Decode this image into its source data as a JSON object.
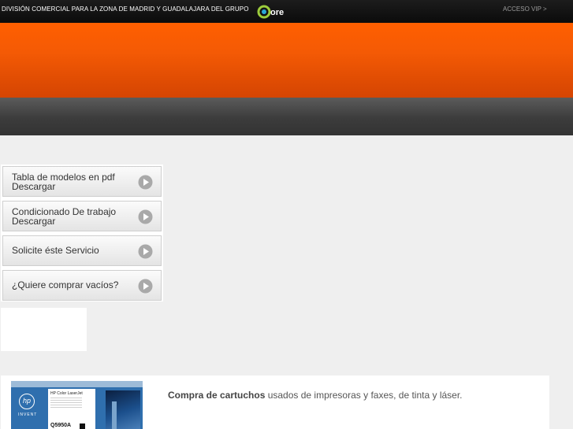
{
  "header": {
    "division_text": "DIVISIÓN COMERCIAL PARA LA ZONA DE MADRID Y GUADALAJARA DEL GRUPO",
    "logo_text": "Core",
    "vip_link": "ACCESO VIP >"
  },
  "sidebar": {
    "items": [
      {
        "line1": "Tabla de modelos en pdf",
        "line2": "Descargar",
        "icon": "play-icon"
      },
      {
        "line1": "Condicionado De trabajo",
        "line2": "Descargar",
        "icon": "play-icon"
      },
      {
        "line1": "Solicite éste Servicio",
        "line2": "",
        "icon": "play-icon"
      },
      {
        "line1": "¿Quiere comprar vacíos?",
        "line2": "",
        "icon": "play-icon"
      }
    ]
  },
  "product": {
    "brand": "hp",
    "brand_sub": "INVENT",
    "label": "HP Color LaserJet",
    "model": "Q5950A"
  },
  "content": {
    "bold": "Compra de cartuchos",
    "rest": " usados de impresoras y faxes, de tinta y láser."
  },
  "colors": {
    "orange": "#ff5f00",
    "topbar": "#111111",
    "dark_band": "#4a4a4a",
    "background": "#efefef"
  }
}
